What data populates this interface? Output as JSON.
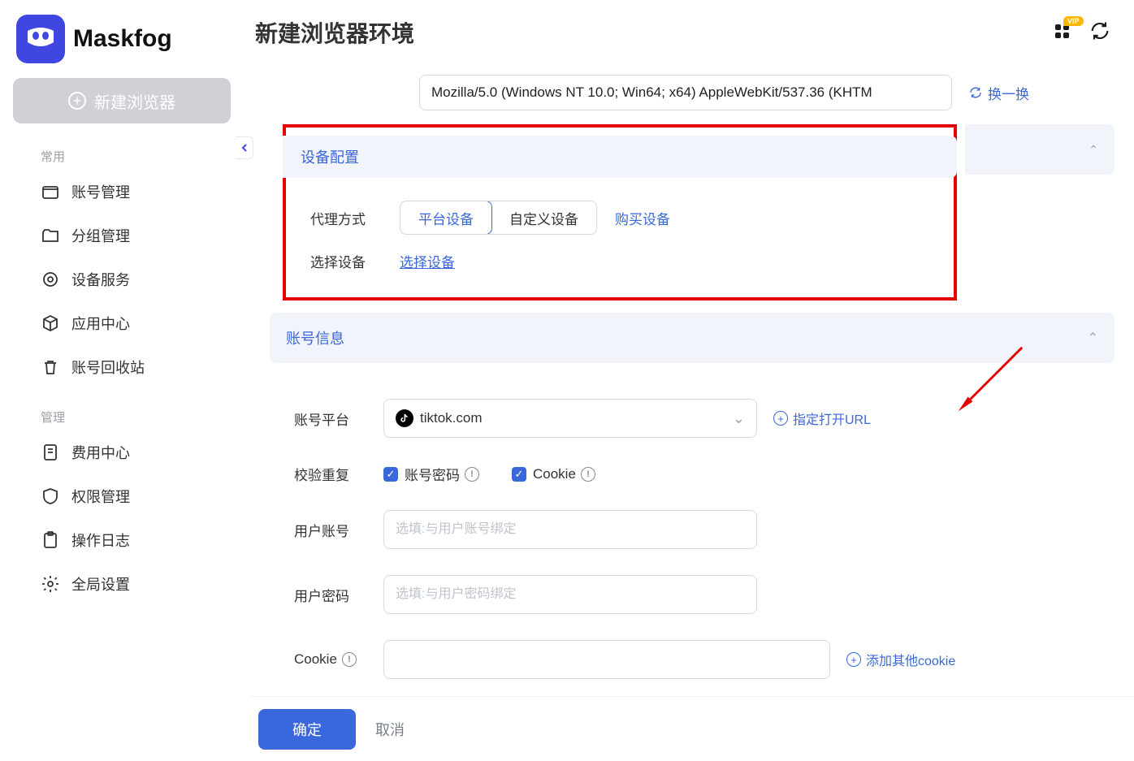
{
  "brand": {
    "name": "Maskfog"
  },
  "sidebar": {
    "new_browser_label": "新建浏览器",
    "section_common": "常用",
    "section_manage": "管理",
    "items_common": [
      {
        "label": "账号管理"
      },
      {
        "label": "分组管理"
      },
      {
        "label": "设备服务"
      },
      {
        "label": "应用中心"
      },
      {
        "label": "账号回收站"
      }
    ],
    "items_manage": [
      {
        "label": "费用中心"
      },
      {
        "label": "权限管理"
      },
      {
        "label": "操作日志"
      },
      {
        "label": "全局设置"
      }
    ]
  },
  "header": {
    "page_title": "新建浏览器环境",
    "vip_badge": "VIP"
  },
  "ua": {
    "value": "Mozilla/5.0 (Windows NT 10.0; Win64; x64) AppleWebKit/537.36 (KHTM",
    "change_label": "换一换"
  },
  "device": {
    "panel_title": "设备配置",
    "proxy_mode_label": "代理方式",
    "seg_platform": "平台设备",
    "seg_custom": "自定义设备",
    "buy_device": "购买设备",
    "select_device_label": "选择设备",
    "select_device_link": "选择设备"
  },
  "account": {
    "panel_title": "账号信息",
    "platform_label": "账号平台",
    "platform_value": "tiktok.com",
    "specify_url_label": "指定打开URL",
    "check_dup_label": "校验重复",
    "chk_user_pass": "账号密码",
    "chk_cookie": "Cookie",
    "user_account_label": "用户账号",
    "user_account_placeholder": "选填:与用户账号绑定",
    "user_password_label": "用户密码",
    "user_password_placeholder": "选填:与用户密码绑定",
    "cookie_label": "Cookie",
    "add_cookie_label": "添加其他cookie"
  },
  "footer": {
    "confirm": "确定",
    "cancel": "取消"
  }
}
